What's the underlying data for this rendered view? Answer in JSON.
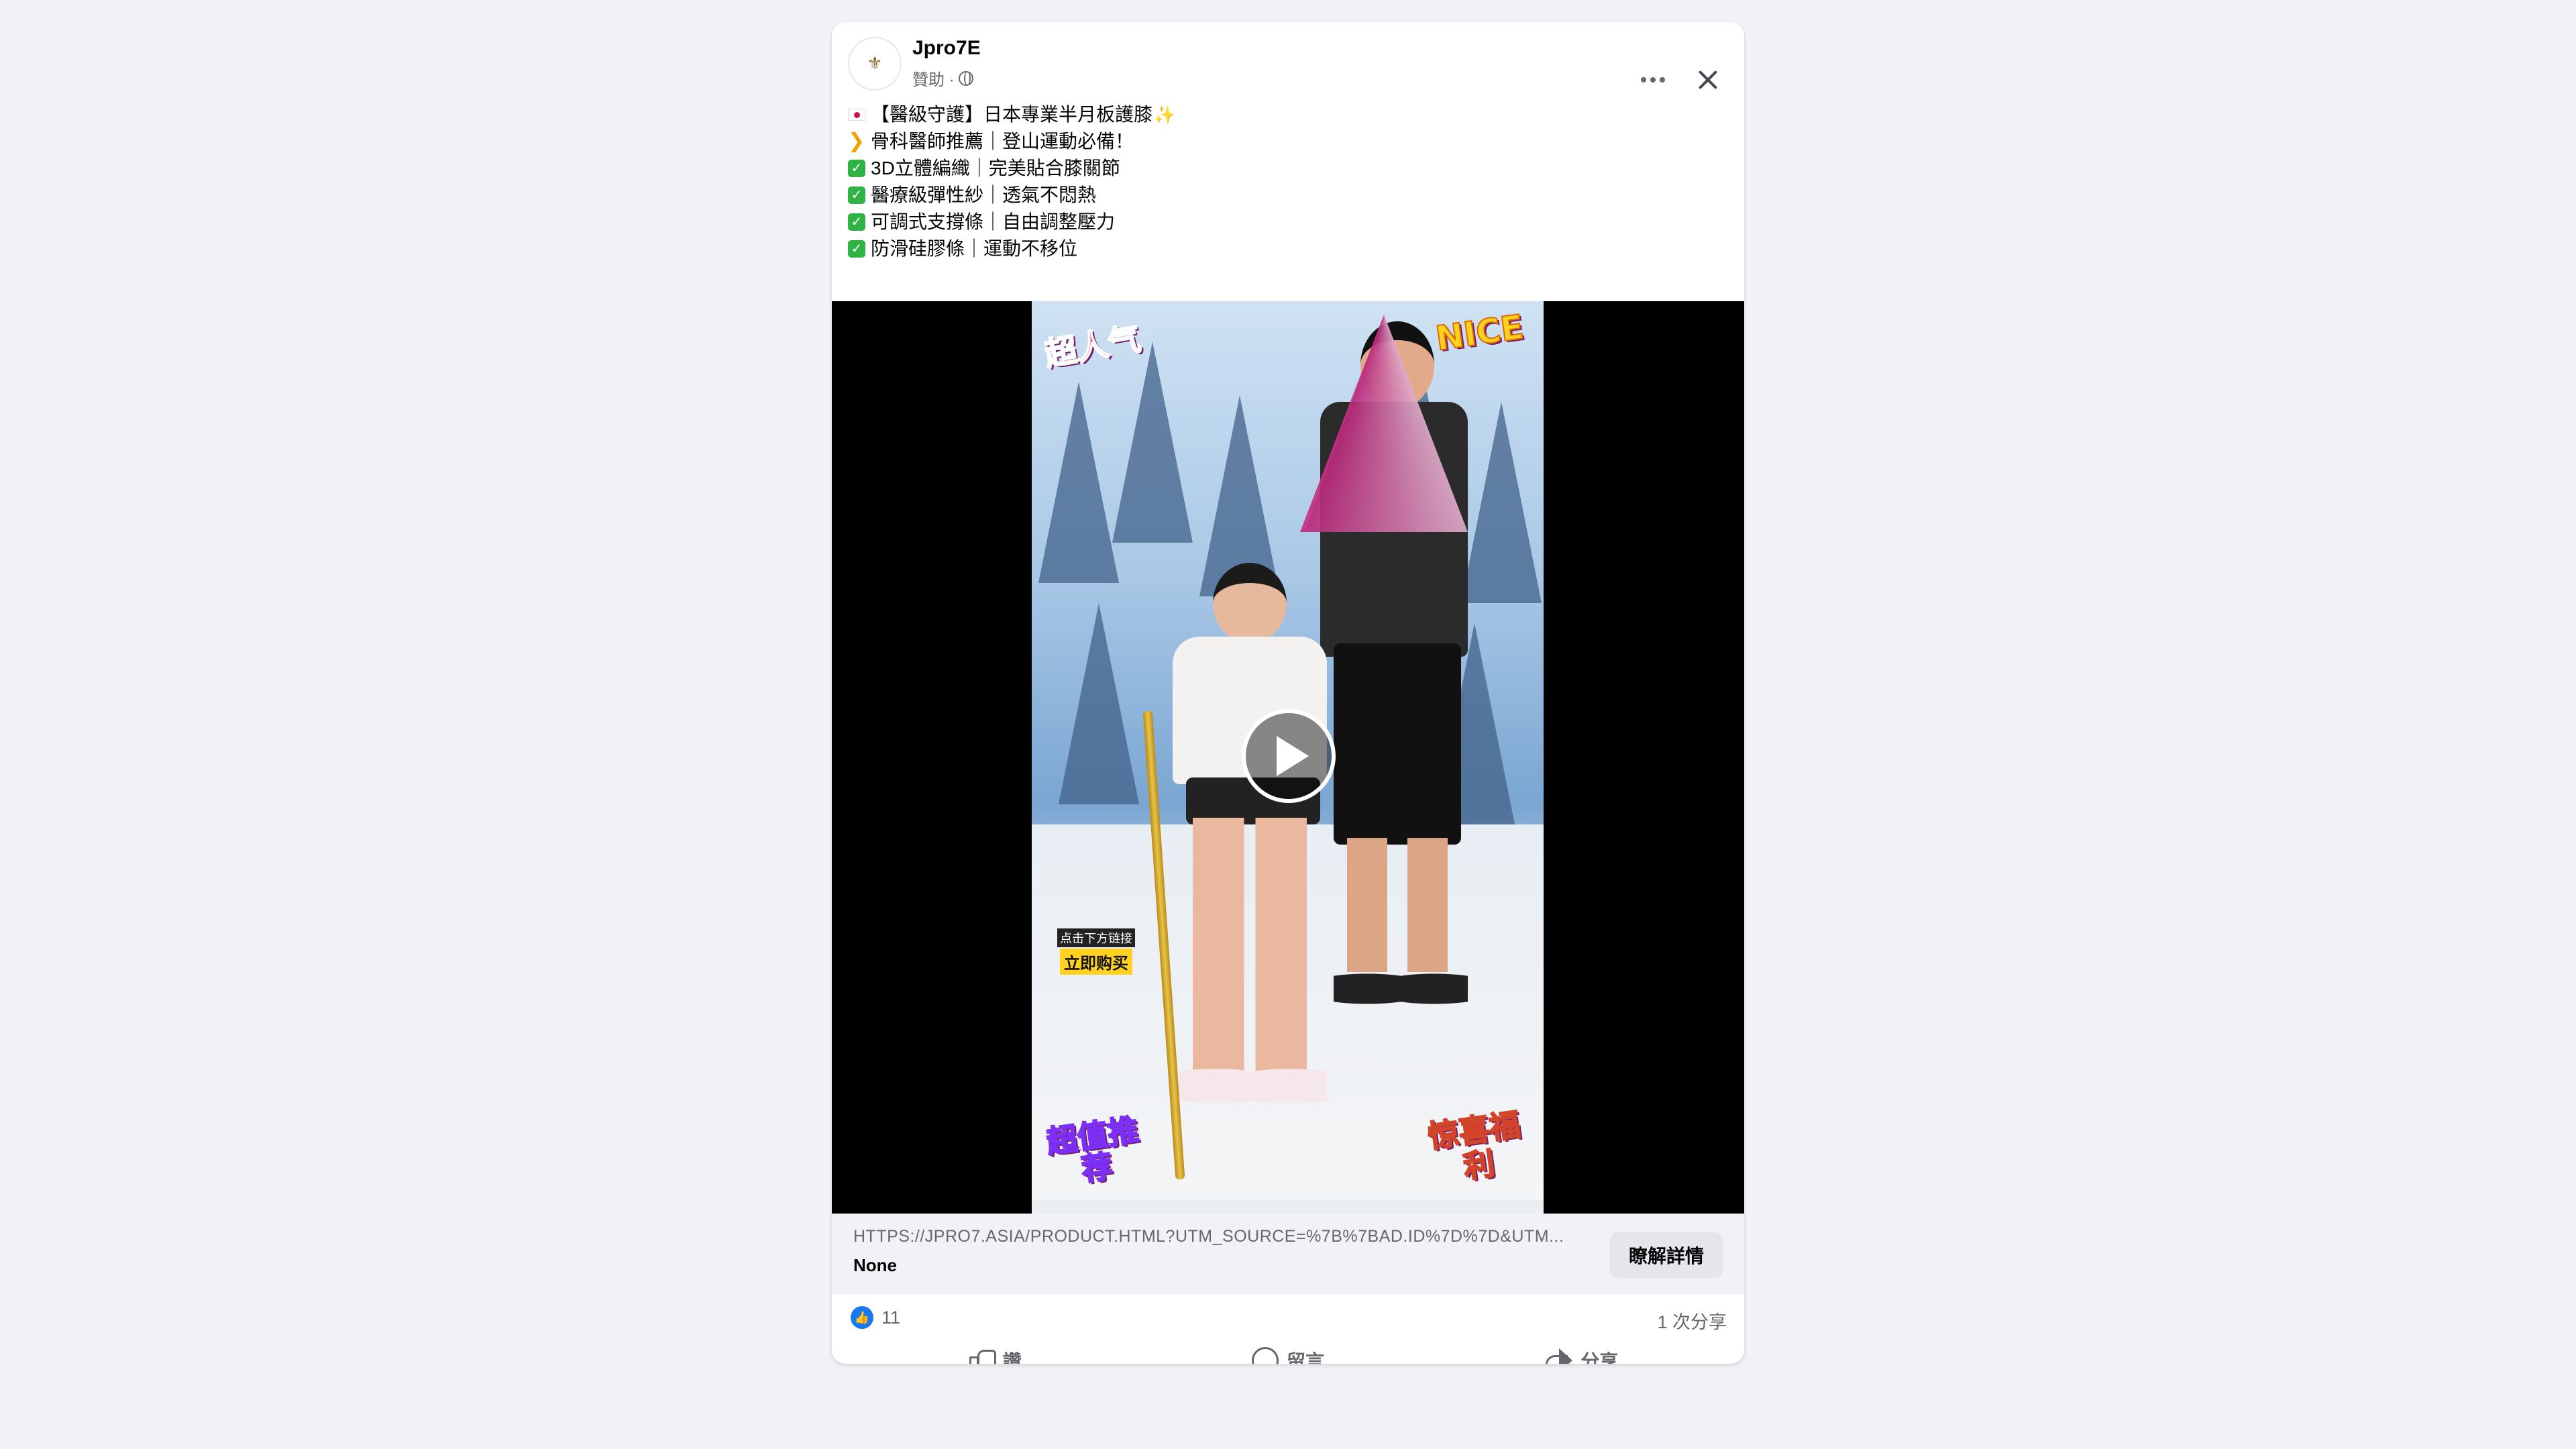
{
  "post": {
    "page_name": "Jpro7E",
    "sponsored_label": "贊助 ·",
    "more_icon": "more-horizontal-icon",
    "close_icon": "close-icon",
    "lines": [
      {
        "icon": "japan-flag-icon",
        "text": "【醫級守護】日本專業半月板護膝",
        "suffix": "✨"
      },
      {
        "icon": "chevron-right-icon",
        "text": "骨科醫師推薦｜登山運動必備！"
      },
      {
        "icon": "check-mark-icon",
        "text": "3D立體編織｜完美貼合膝關節"
      },
      {
        "icon": "check-mark-icon",
        "text": "醫療級彈性紗｜透氣不悶熱"
      },
      {
        "icon": "check-mark-icon",
        "text": "可調式支撐條｜自由調整壓力"
      },
      {
        "icon": "check-mark-icon",
        "text": "防滑硅膠條｜運動不移位"
      }
    ]
  },
  "video": {
    "sticker_top_left": "超人气",
    "sticker_top_right": "NICE",
    "sticker_bottom_left": "超值推荐",
    "sticker_bottom_right": "惊喜福利",
    "buy_hint_small": "点击下方链接",
    "buy_hint_big": "立即购买",
    "play_icon": "play-icon"
  },
  "link": {
    "url": "HTTPS://JPRO7.ASIA/PRODUCT.HTML?UTM_SOURCE=%7B%7BAD.ID%7D%7D&UTM...",
    "title": "None",
    "cta_label": "瞭解詳情"
  },
  "stats": {
    "likes": "11",
    "shares": "1 次分享"
  },
  "actions": {
    "like_label": "讚",
    "comment_label": "留言",
    "share_label": "分享"
  },
  "colors": {
    "background": "#f0f2f5",
    "card": "#ffffff",
    "link_bar": "#f0f2f5",
    "like_blue": "#1877f2",
    "check_green": "#2fb344",
    "secondary_text": "#65676b"
  }
}
